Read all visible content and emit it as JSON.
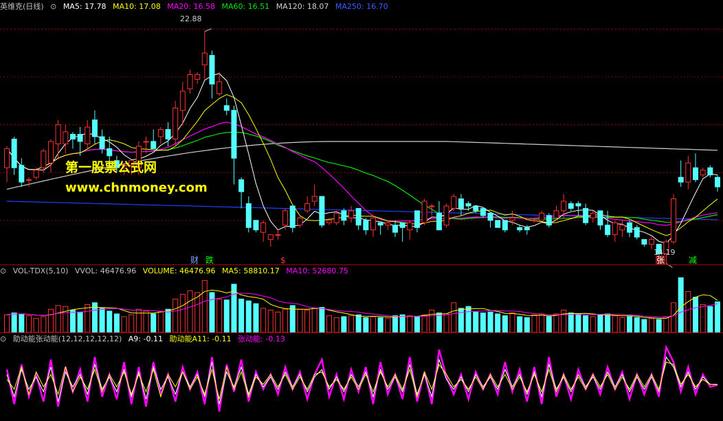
{
  "header": {
    "title": "英维克(日线)",
    "ma5": "MA5: 17.78",
    "ma10": "MA10: 17.08",
    "ma20": "MA20: 16.58",
    "ma60": "MA60: 16.51",
    "ma120": "MA120: 18.07",
    "ma250": "MA250: 16.70"
  },
  "vol_header": {
    "name": "VOL-TDX(5,10)",
    "vvol": "VVOL: 46476.96",
    "volume": "VOLUME: 46476.96",
    "ma5": "MA5: 58810.17",
    "ma10": "MA10: 52680.75"
  },
  "ind_header": {
    "name": "助动能张动能(12,12,12,12,12)",
    "a9": "A9: -0.11",
    "a11": "助动能A11: -0.11",
    "zdn": "张动能: -0.13"
  },
  "watermark": {
    "line1": "第一股票公式网",
    "line2": "www.chnmoney.com"
  },
  "markers": {
    "cai": "财",
    "die": "跌",
    "dollar": "$",
    "zhang": "张",
    "jian": "减"
  },
  "colors": {
    "up": "#ff3232",
    "down": "#54ffff",
    "ma5": "#ffffff",
    "ma10": "#ffff00",
    "ma20": "#ff00ff",
    "ma60": "#00e600",
    "ma120": "#d0d0d0",
    "ma250": "#2040ff",
    "grid": "#8b0000"
  },
  "chart_data": [
    {
      "type": "candlestick",
      "title": "英维克(日线)",
      "ylim": [
        13.3,
        23.7
      ],
      "annotations": {
        "high": "22.88",
        "low": "14.19"
      },
      "candles": [
        [
          17.2,
          18.0,
          16.6,
          18.1
        ],
        [
          18.4,
          17.2,
          16.9,
          18.5
        ],
        [
          17.3,
          16.6,
          16.4,
          17.6
        ],
        [
          16.7,
          16.7,
          16.4,
          16.8
        ],
        [
          16.8,
          17.1,
          16.7,
          17.2
        ],
        [
          17.2,
          17.9,
          17.0,
          18.0
        ],
        [
          17.4,
          18.3,
          17.0,
          18.4
        ],
        [
          18.2,
          19.0,
          17.6,
          19.2
        ],
        [
          18.2,
          18.7,
          17.8,
          19.0
        ],
        [
          18.6,
          18.4,
          18.0,
          18.7
        ],
        [
          18.6,
          18.3,
          17.7,
          18.9
        ],
        [
          18.2,
          18.9,
          18.0,
          19.2
        ],
        [
          19.2,
          18.5,
          18.2,
          19.6
        ],
        [
          18.5,
          18.0,
          17.8,
          18.8
        ],
        [
          18.0,
          17.7,
          17.3,
          18.5
        ],
        [
          17.5,
          17.2,
          17.0,
          17.7
        ],
        [
          17.3,
          17.3,
          16.9,
          17.4
        ],
        [
          17.3,
          17.5,
          16.9,
          17.5
        ],
        [
          17.2,
          18.1,
          16.9,
          18.3
        ],
        [
          18.3,
          18.3,
          17.8,
          18.5
        ],
        [
          18.3,
          18.0,
          18.0,
          18.8
        ],
        [
          18.5,
          18.8,
          18.2,
          18.9
        ],
        [
          18.8,
          18.4,
          18.1,
          19.1
        ],
        [
          18.4,
          19.7,
          18.1,
          20.0
        ],
        [
          19.6,
          20.4,
          19.0,
          20.8
        ],
        [
          20.5,
          21.1,
          20.3,
          21.3
        ],
        [
          20.9,
          21.1,
          20.7,
          21.2
        ],
        [
          21.5,
          22.0,
          20.9,
          22.9
        ],
        [
          21.9,
          20.7,
          20.1,
          22.1
        ],
        [
          20.3,
          20.8,
          20.2,
          21.2
        ],
        [
          19.8,
          19.6,
          19.4,
          20.1
        ],
        [
          19.6,
          17.6,
          16.5,
          19.8
        ],
        [
          16.7,
          16.2,
          15.5,
          16.8
        ],
        [
          15.7,
          14.7,
          14.5,
          16.0
        ],
        [
          15.0,
          14.6,
          14.5,
          15.0
        ],
        [
          14.5,
          14.9,
          14.1,
          15.0
        ],
        [
          14.2,
          14.4,
          13.9,
          14.4
        ],
        [
          14.4,
          14.4,
          14.2,
          14.6
        ],
        [
          14.8,
          15.4,
          14.6,
          15.5
        ],
        [
          15.6,
          14.7,
          14.5,
          15.6
        ],
        [
          14.8,
          15.1,
          14.7,
          15.2
        ],
        [
          15.4,
          15.7,
          15.3,
          16.0
        ],
        [
          15.8,
          16.0,
          15.6,
          16.5
        ],
        [
          16.0,
          14.8,
          14.7,
          16.0
        ],
        [
          14.9,
          15.0,
          14.8,
          15.1
        ],
        [
          14.9,
          15.3,
          14.8,
          15.4
        ],
        [
          15.4,
          15.0,
          14.8,
          15.5
        ],
        [
          15.1,
          15.4,
          14.9,
          15.6
        ],
        [
          15.5,
          14.8,
          14.6,
          15.5
        ],
        [
          15.0,
          14.6,
          14.4,
          15.1
        ],
        [
          14.6,
          15.1,
          14.3,
          15.2
        ],
        [
          14.9,
          14.8,
          14.4,
          14.9
        ],
        [
          14.8,
          14.9,
          14.6,
          15.0
        ],
        [
          14.8,
          14.5,
          14.3,
          15.0
        ],
        [
          14.9,
          14.7,
          14.1,
          14.9
        ],
        [
          14.6,
          14.9,
          14.2,
          15.0
        ],
        [
          15.4,
          14.7,
          14.5,
          15.4
        ],
        [
          14.9,
          15.8,
          14.8,
          15.9
        ],
        [
          15.6,
          15.6,
          15.2,
          15.7
        ],
        [
          15.3,
          14.6,
          14.6,
          15.8
        ],
        [
          14.8,
          15.6,
          14.7,
          15.7
        ],
        [
          15.5,
          16.0,
          15.4,
          16.1
        ],
        [
          15.9,
          15.5,
          15.2,
          16.1
        ],
        [
          15.7,
          15.6,
          15.4,
          15.8
        ],
        [
          15.6,
          15.4,
          15.3,
          15.6
        ],
        [
          15.5,
          15.2,
          15.1,
          15.5
        ],
        [
          15.3,
          15.0,
          14.7,
          15.3
        ],
        [
          15.0,
          14.7,
          14.7,
          15.0
        ],
        [
          15.0,
          14.6,
          14.5,
          15.0
        ],
        [
          15.0,
          15.1,
          14.8,
          15.4
        ],
        [
          14.7,
          14.6,
          14.5,
          14.8
        ],
        [
          14.7,
          14.6,
          14.4,
          14.8
        ],
        [
          15.0,
          15.0,
          14.9,
          15.1
        ],
        [
          15.0,
          15.3,
          15.0,
          15.4
        ],
        [
          15.2,
          14.8,
          14.7,
          15.3
        ],
        [
          15.1,
          15.4,
          15.0,
          15.6
        ],
        [
          15.4,
          15.8,
          15.1,
          16.1
        ],
        [
          15.7,
          15.5,
          15.4,
          15.8
        ],
        [
          15.7,
          15.6,
          15.2,
          15.8
        ],
        [
          15.5,
          14.9,
          14.8,
          15.7
        ],
        [
          15.1,
          15.3,
          14.9,
          15.4
        ],
        [
          15.4,
          14.8,
          14.6,
          15.4
        ],
        [
          14.8,
          14.4,
          14.3,
          15.4
        ],
        [
          14.4,
          14.9,
          14.1,
          15.0
        ],
        [
          14.6,
          14.8,
          14.3,
          15.0
        ],
        [
          14.9,
          14.5,
          14.3,
          15.0
        ],
        [
          14.7,
          14.3,
          14.2,
          14.8
        ],
        [
          14.2,
          14.0,
          13.9,
          14.2
        ],
        [
          14.0,
          14.2,
          13.8,
          14.3
        ],
        [
          14.0,
          13.6,
          13.4,
          14.0
        ],
        [
          13.6,
          14.1,
          13.2,
          14.2
        ],
        [
          14.1,
          15.9,
          14.0,
          16.1
        ],
        [
          16.8,
          16.6,
          16.4,
          17.5
        ],
        [
          16.6,
          17.4,
          16.3,
          17.7
        ],
        [
          17.2,
          16.7,
          16.6,
          17.8
        ],
        [
          16.9,
          17.1,
          16.8,
          17.2
        ],
        [
          17.2,
          16.9,
          16.8,
          17.3
        ],
        [
          16.8,
          16.4,
          16.2,
          16.9
        ]
      ]
    },
    {
      "type": "bar",
      "title": "VOL-TDX(5,10)",
      "values": [
        38,
        42,
        40,
        36,
        30,
        34,
        50,
        58,
        56,
        48,
        44,
        60,
        64,
        52,
        46,
        40,
        34,
        38,
        50,
        46,
        40,
        46,
        50,
        72,
        82,
        90,
        86,
        112,
        86,
        72,
        70,
        104,
        72,
        68,
        62,
        52,
        48,
        44,
        50,
        58,
        50,
        48,
        52,
        54,
        36,
        32,
        34,
        36,
        38,
        32,
        34,
        32,
        30,
        36,
        38,
        36,
        34,
        38,
        48,
        42,
        40,
        64,
        52,
        56,
        44,
        42,
        44,
        40,
        36,
        42,
        34,
        32,
        38,
        40,
        34,
        40,
        48,
        42,
        40,
        36,
        34,
        38,
        40,
        36,
        32,
        34,
        32,
        28,
        30,
        28,
        34,
        64,
        118,
        88,
        76,
        60,
        56,
        66
      ]
    },
    {
      "type": "line",
      "title": "助动能张动能(12,12,12,12,12)",
      "series": [
        {
          "name": "A9",
          "values": [
            0.3,
            -0.6,
            0.5,
            -0.3,
            0.2,
            -0.4,
            0.6,
            -0.8,
            0.4,
            -0.2,
            0.3,
            -0.5,
            0.7,
            -0.3,
            0.2,
            -0.4,
            0.5,
            -0.6,
            0.4,
            -0.7,
            0.6,
            -0.3,
            0.2,
            -0.5,
            0.4,
            -0.2,
            0.3,
            -0.6,
            0.8,
            -0.9,
            0.4,
            -0.2,
            0.6,
            -0.5,
            0.3,
            -0.2,
            0.2,
            -0.3,
            0.4,
            -0.2,
            0.3,
            -0.4,
            0.2,
            0.5,
            -0.3,
            0.2,
            -0.4,
            0.3,
            -0.2,
            0.4,
            -0.6,
            0.5,
            -0.3,
            0.2,
            -0.4,
            0.7,
            -0.5,
            0.3,
            -0.6,
            0.9,
            0.1,
            -0.3,
            0.2,
            -0.4,
            0.3,
            -0.2,
            0.2,
            -0.3,
            0.5,
            -0.2,
            0.3,
            -0.5,
            0.4,
            -0.6,
            0.7,
            -0.3,
            0.2,
            -0.4,
            0.3,
            -0.2,
            0.2,
            -0.3,
            0.4,
            -0.2,
            0.3,
            -0.4,
            0.2,
            -0.3,
            0.2,
            -0.4,
            1.0,
            0.6,
            -0.2,
            0.4,
            -0.3,
            0.2,
            -0.1,
            -0.1
          ]
        },
        {
          "name": "助动能A11",
          "values": [
            0.1,
            -0.3,
            0.6,
            -0.5,
            0.4,
            -0.2,
            0.3,
            -0.5,
            0.6,
            -0.4,
            0.2,
            -0.3,
            0.5,
            -0.4,
            0.3,
            -0.2,
            0.4,
            -0.5,
            0.3,
            -0.4,
            0.5,
            -0.6,
            0.3,
            -0.2,
            0.4,
            -0.3,
            0.2,
            -0.5,
            0.5,
            -0.7,
            0.6,
            -0.3,
            0.4,
            -0.6,
            0.2,
            -0.1,
            0.3,
            -0.2,
            0.3,
            -0.3,
            0.2,
            -0.3,
            0.3,
            0.4,
            -0.2,
            0.1,
            -0.3,
            0.2,
            -0.3,
            0.3,
            -0.4,
            0.4,
            -0.2,
            0.3,
            -0.3,
            0.5,
            -0.6,
            0.4,
            -0.3,
            0.7,
            0.3,
            -0.2,
            0.1,
            -0.3,
            0.2,
            -0.3,
            0.3,
            -0.2,
            0.3,
            -0.3,
            0.2,
            -0.4,
            0.3,
            -0.4,
            0.5,
            -0.4,
            0.3,
            -0.3,
            0.2,
            -0.3,
            0.3,
            -0.2,
            0.3,
            -0.3,
            0.2,
            -0.3,
            0.3,
            -0.2,
            0.3,
            -0.3,
            0.8,
            0.7,
            -0.1,
            0.3,
            -0.2,
            0.1,
            -0.1,
            -0.11
          ]
        },
        {
          "name": "张动能",
          "values": [
            0.5,
            -0.9,
            0.7,
            -0.6,
            0.3,
            -0.8,
            0.9,
            -1.0,
            0.6,
            -0.4,
            0.5,
            -0.8,
            1.0,
            -0.6,
            0.3,
            -0.7,
            0.8,
            -0.9,
            0.6,
            -1.0,
            0.8,
            -0.5,
            0.3,
            -0.8,
            0.6,
            -0.3,
            0.4,
            -0.9,
            1.0,
            -1.2,
            0.7,
            -0.4,
            0.9,
            -0.8,
            0.4,
            -0.3,
            0.3,
            -0.5,
            0.6,
            -0.3,
            0.4,
            -0.7,
            0.3,
            0.9,
            -0.6,
            0.3,
            -0.7,
            0.5,
            -0.4,
            0.6,
            -0.9,
            0.8,
            -0.5,
            0.3,
            -0.7,
            1.0,
            -0.8,
            0.4,
            -0.9,
            1.3,
            0.2,
            -0.5,
            0.3,
            -0.7,
            0.4,
            -0.3,
            0.3,
            -0.5,
            0.8,
            -0.4,
            0.5,
            -0.8,
            0.6,
            -0.9,
            1.0,
            -0.6,
            0.3,
            -0.7,
            0.5,
            -0.3,
            0.3,
            -0.5,
            0.6,
            -0.3,
            0.4,
            -0.7,
            0.3,
            -0.5,
            0.3,
            -0.6,
            1.4,
            0.8,
            -0.4,
            0.6,
            -0.5,
            0.3,
            -0.2,
            -0.13
          ]
        }
      ]
    }
  ]
}
